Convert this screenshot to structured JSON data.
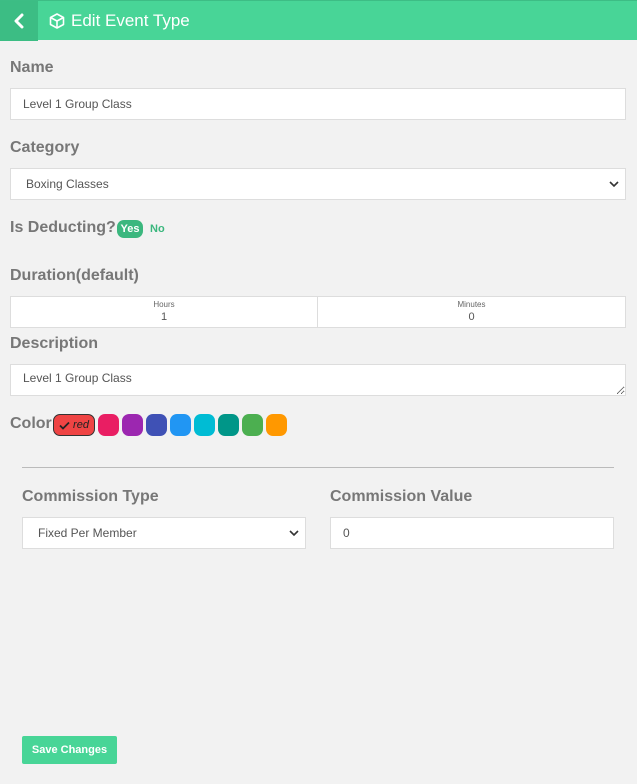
{
  "header": {
    "title": "Edit Event Type",
    "back_icon": "chevron-left-icon",
    "title_icon": "cube-icon",
    "bg_color": "#48d597"
  },
  "form": {
    "name": {
      "label": "Name",
      "value": "Level 1 Group Class"
    },
    "category": {
      "label": "Category",
      "selected": "Boxing Classes"
    },
    "deducting": {
      "label": "Is Deducting?",
      "yes_label": "Yes",
      "no_label": "No",
      "selected": "Yes"
    },
    "duration": {
      "label": "Duration(default)",
      "hours_label": "Hours",
      "hours_value": "1",
      "minutes_label": "Minutes",
      "minutes_value": "0"
    },
    "description": {
      "label": "Description",
      "value": "Level 1 Group Class"
    },
    "color": {
      "label": "Color",
      "selected_label": "red",
      "selected_hex": "#ef4444",
      "swatches": [
        "#e91e63",
        "#9c27b0",
        "#3f51b5",
        "#2196f3",
        "#00bcd4",
        "#009688",
        "#4caf50",
        "#ff9800"
      ]
    },
    "commission_type": {
      "label": "Commission Type",
      "selected": "Fixed Per Member"
    },
    "commission_value": {
      "label": "Commission Value",
      "value": "0"
    }
  },
  "actions": {
    "save_label": "Save Changes"
  }
}
